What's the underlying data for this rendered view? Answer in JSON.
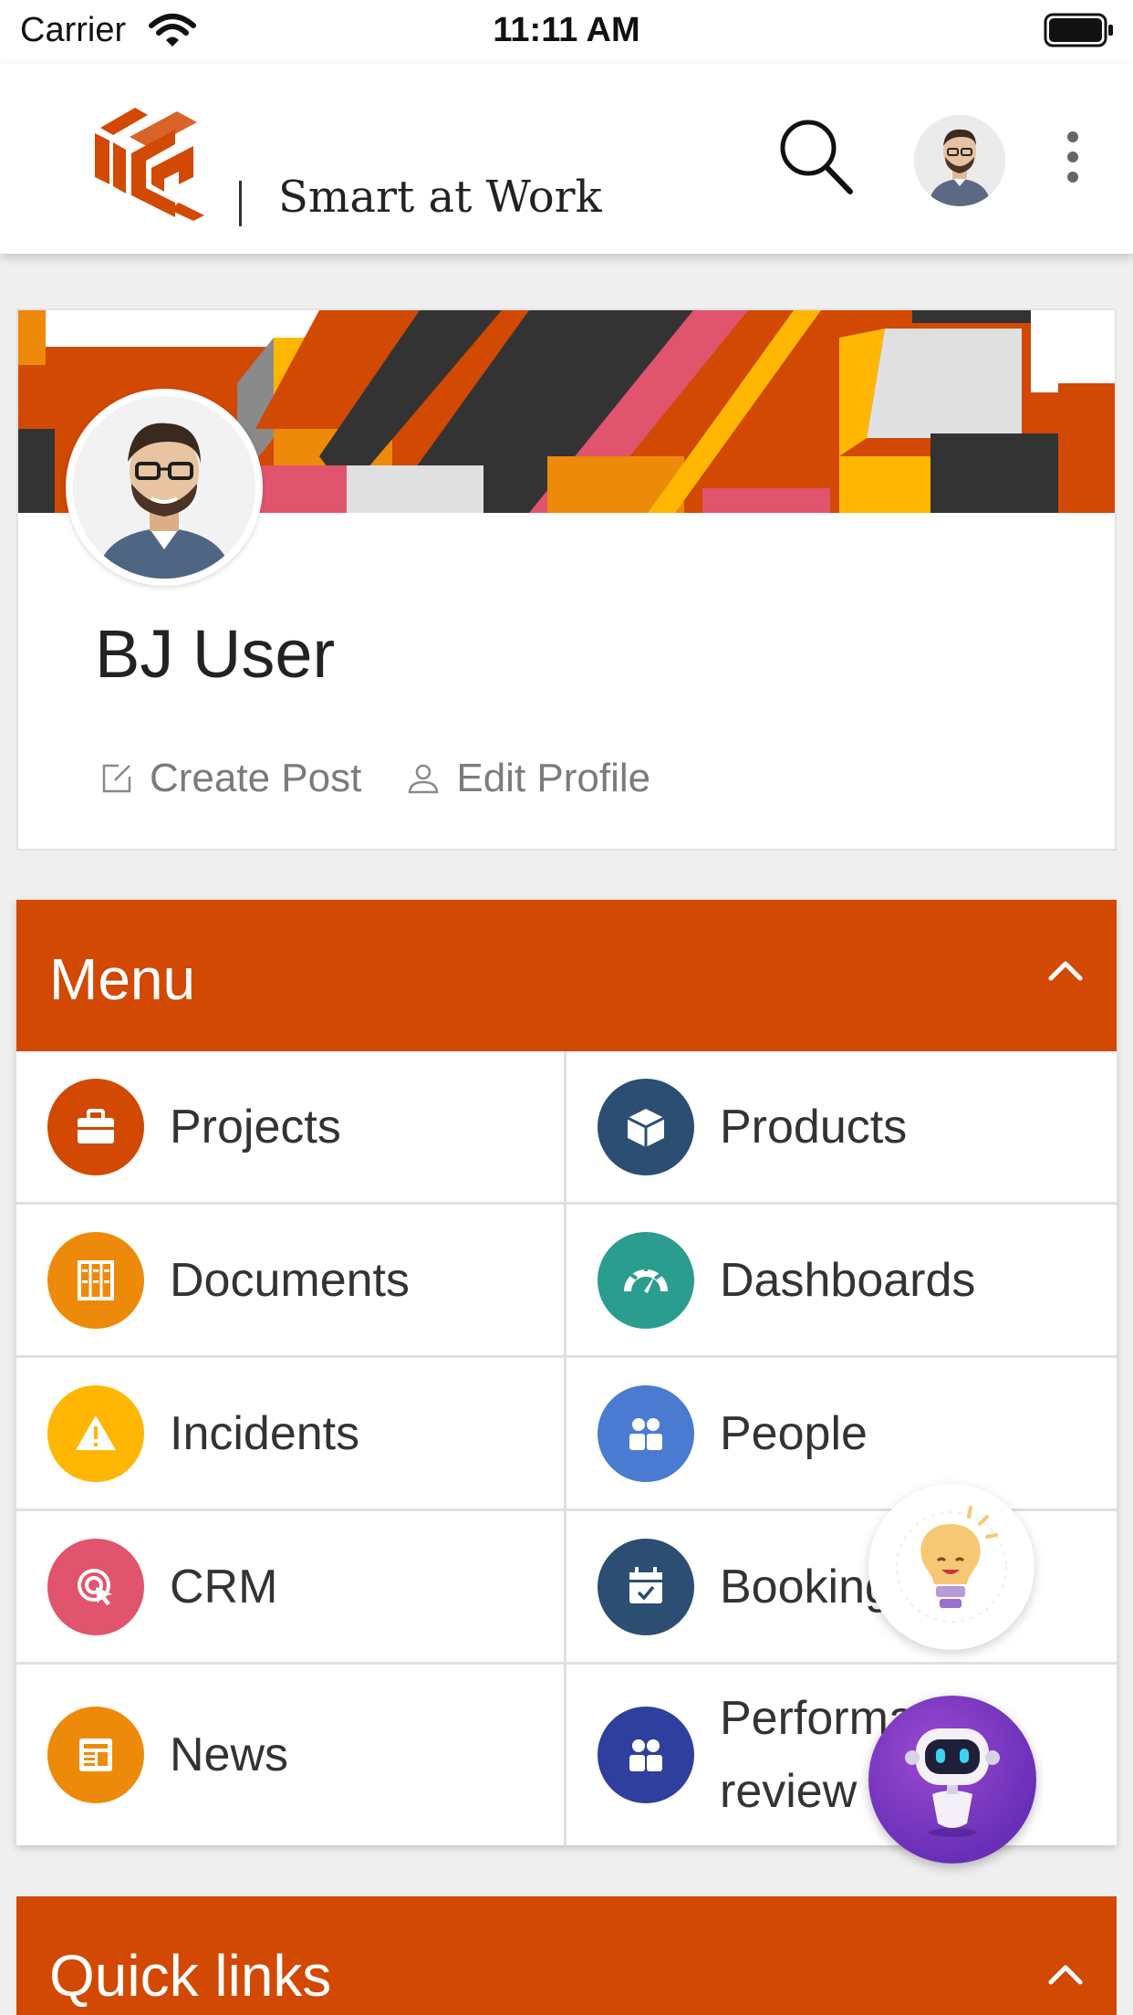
{
  "status_bar": {
    "carrier": "Carrier",
    "time": "11:11 AM",
    "wifi_icon": "wifi-icon",
    "battery_icon": "battery-icon"
  },
  "header": {
    "brand": "Smart at Work",
    "logo_icon": "company-logo",
    "search_icon": "search-icon",
    "overflow_icon": "kebab-menu-icon",
    "avatar_icon": "user-avatar"
  },
  "profile": {
    "name": "BJ User",
    "create_post": "Create Post",
    "edit_profile": "Edit Profile"
  },
  "menu": {
    "title": "Menu",
    "items": [
      {
        "label": "Projects",
        "icon": "briefcase-icon",
        "color": "#d14903"
      },
      {
        "label": "Products",
        "icon": "box-icon",
        "color": "#2b4e72"
      },
      {
        "label": "Documents",
        "icon": "cabinet-icon",
        "color": "#ee8a0a"
      },
      {
        "label": "Dashboards",
        "icon": "gauge-icon",
        "color": "#2a9d8f"
      },
      {
        "label": "Incidents",
        "icon": "warning-icon",
        "color": "#ffb703"
      },
      {
        "label": "People",
        "icon": "people-icon",
        "color": "#4a7bd0"
      },
      {
        "label": "CRM",
        "icon": "target-cursor-icon",
        "color": "#e0546e"
      },
      {
        "label": "Bookings",
        "icon": "calendar-check-icon",
        "color": "#2b4e72"
      },
      {
        "label": "News",
        "icon": "newspaper-icon",
        "color": "#ee8a0a"
      },
      {
        "label": "Performance review",
        "icon": "people-icon",
        "color": "#2f3f9e"
      }
    ]
  },
  "quick_links": {
    "title": "Quick links"
  },
  "colors": {
    "accent": "#d14903",
    "background": "#efefef"
  }
}
